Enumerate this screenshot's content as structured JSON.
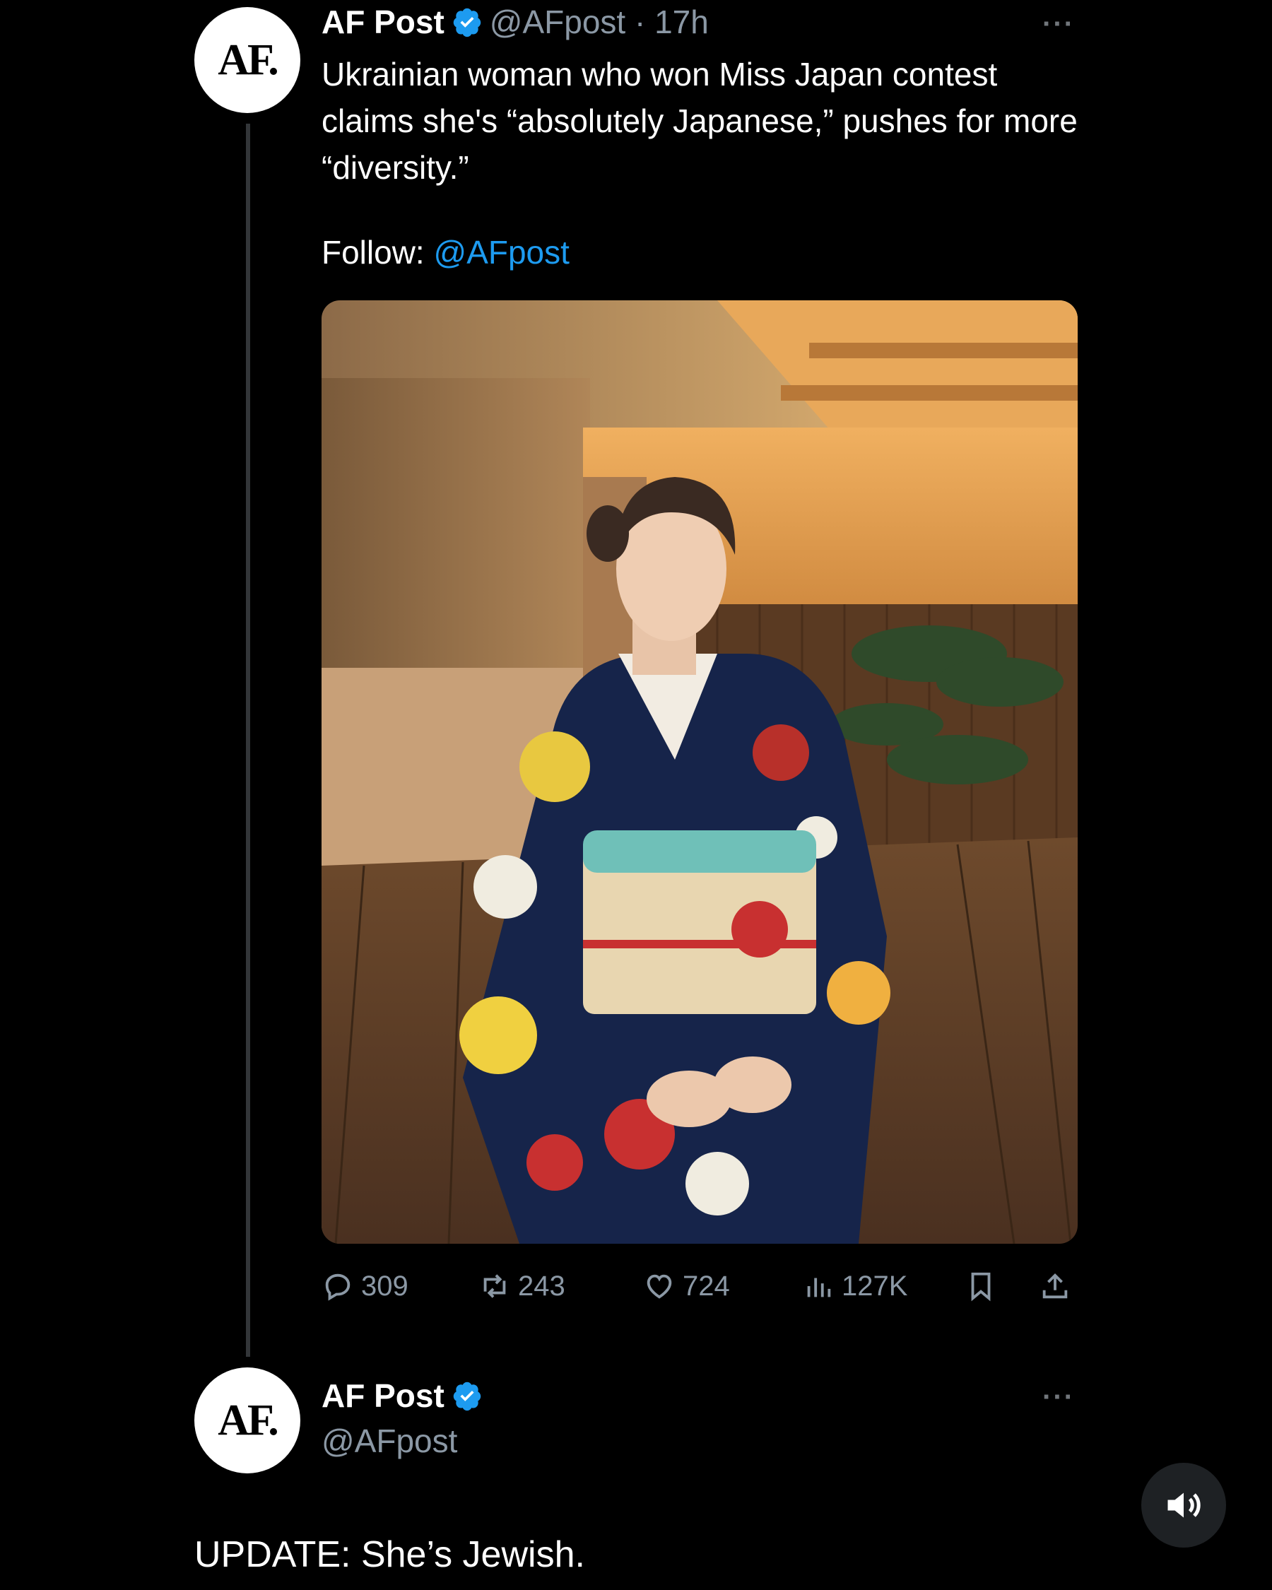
{
  "tweet1": {
    "avatar_text": "AF.",
    "name": "AF Post",
    "handle_time": "@AFpost · 17h",
    "more": "···",
    "text": "Ukrainian woman who won Miss Japan contest claims she's “absolutely Japanese,” pushes for more “diversity.”",
    "follow_label": "Follow:",
    "follow_link": "@AFpost",
    "stats": {
      "replies": "309",
      "reposts": "243",
      "likes": "724",
      "views": "127K"
    }
  },
  "tweet2": {
    "avatar_text": "AF.",
    "name": "AF Post",
    "handle": "@AFpost",
    "more": "···",
    "text": "UPDATE: She’s Jewish."
  },
  "colors": {
    "background": "#000000",
    "link": "#1d9bf0",
    "verified": "#1d9bf0",
    "muted": "#8b98a5"
  },
  "icons": [
    "verified-badge-icon",
    "reply-icon",
    "repost-icon",
    "like-icon",
    "views-icon",
    "bookmark-icon",
    "share-icon",
    "sound-icon"
  ]
}
